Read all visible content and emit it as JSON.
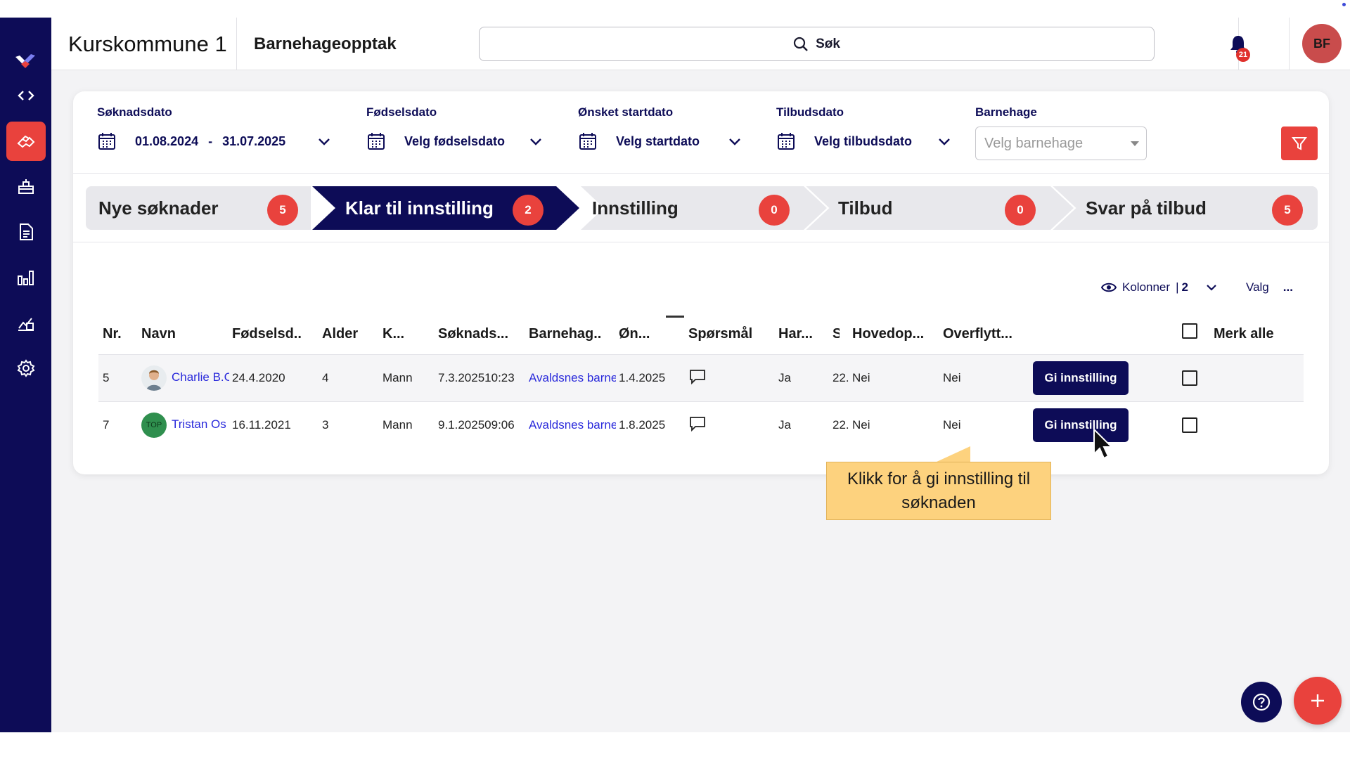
{
  "header": {
    "org": "Kurskommune 1",
    "app": "Barnehageopptak",
    "search_label": "Søk",
    "notification_count": "21",
    "avatar_initials": "BF"
  },
  "filters": {
    "soknadsdato": {
      "label": "Søknadsdato",
      "from": "01.08.2024",
      "sep": "-",
      "to": "31.07.2025"
    },
    "fodselsdato": {
      "label": "Fødselsdato",
      "value": "Velg fødselsdato"
    },
    "startdato": {
      "label": "Ønsket startdato",
      "value": "Velg startdato"
    },
    "tilbudsdato": {
      "label": "Tilbudsdato",
      "value": "Velg tilbudsdato"
    },
    "barnehage": {
      "label": "Barnehage",
      "placeholder": "Velg barnehage"
    }
  },
  "steps": [
    {
      "label": "Nye søknader",
      "count": "5"
    },
    {
      "label": "Klar til innstilling",
      "count": "2"
    },
    {
      "label": "Innstilling",
      "count": "0"
    },
    {
      "label": "Tilbud",
      "count": "0"
    },
    {
      "label": "Svar på tilbud",
      "count": "5"
    }
  ],
  "toolbar": {
    "columns_label": "Kolonner",
    "columns_sep": "|",
    "columns_count": "2",
    "options_label": "Valg",
    "options_more": "..."
  },
  "table": {
    "headers": [
      "Nr.",
      "Navn",
      "Fødselsd...",
      "Alder",
      "K...",
      "Søknads...",
      "Barnehag...",
      "Øn...",
      "Spørsmål",
      "Har...",
      "S",
      "Hovedop...",
      "Overflytt..."
    ],
    "select_all": "Merk alle",
    "rows": [
      {
        "nr": "5",
        "navn": "Charlie B.C",
        "fodt": "24.4.2020",
        "alder": "4",
        "kjonn": "Mann",
        "soknad": "7.3.202510:23",
        "barnehage": "Avaldsnes barne",
        "onsket": "1.4.2025",
        "har": "Ja",
        "s": "22.",
        "hoved": "Nei",
        "overflytt": "Nei",
        "action": "Gi innstilling"
      },
      {
        "nr": "7",
        "navn": "Tristan Os",
        "avatar_text": "TOP",
        "fodt": "16.11.2021",
        "alder": "3",
        "kjonn": "Mann",
        "soknad": "9.1.202509:06",
        "barnehage": "Avaldsnes barne",
        "onsket": "1.8.2025",
        "har": "Ja",
        "s": "22.",
        "hoved": "Nei",
        "overflytt": "Nei",
        "action": "Gi innstilling"
      }
    ]
  },
  "tooltip": {
    "text": "Klikk for å gi innstilling til søknaden"
  },
  "colors": {
    "navy": "#0d0c57",
    "red": "#e9423d",
    "tooltip": "#fdd27e",
    "link": "#2a2adb"
  },
  "icons": [
    "logo-icon",
    "code-icon",
    "hands-icon",
    "inbox-icon",
    "document-icon",
    "bar-chart-icon",
    "building-chart-icon",
    "gear-icon",
    "search-icon",
    "bell-icon",
    "calendar-icon",
    "chevron-down-icon",
    "filter-icon",
    "eye-icon",
    "chat-icon",
    "help-icon",
    "plus-icon",
    "cursor-icon"
  ]
}
